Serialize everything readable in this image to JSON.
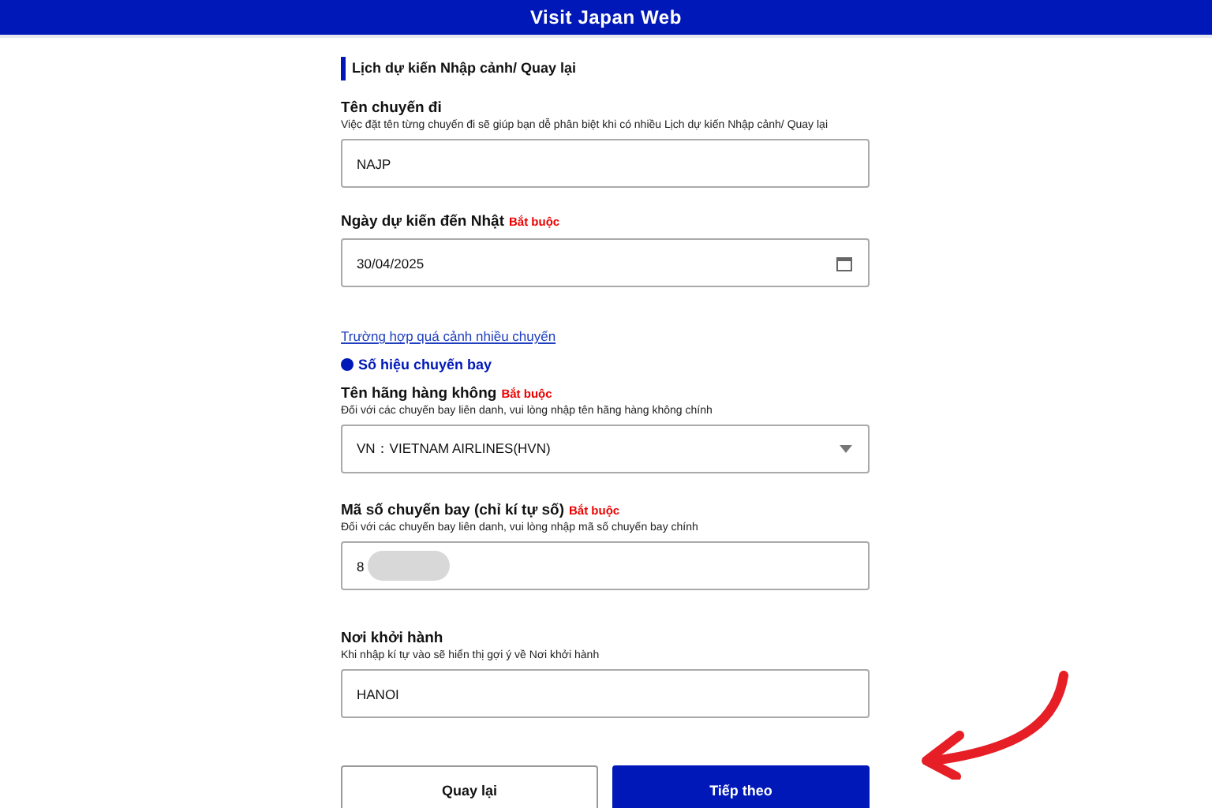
{
  "header": {
    "title": "Visit Japan Web"
  },
  "section_title": "Lịch dự kiến Nhập cảnh/ Quay lại",
  "fields_top": [
    {
      "kind": "text",
      "label": "Tên chuyến đi",
      "hint": "Việc đặt tên từng chuyến đi sẽ giúp bạn dễ phân biệt khi có nhiều Lịch dự kiến Nhập cảnh/ Quay lại",
      "value": "NAJP"
    },
    {
      "kind": "date",
      "label": "Ngày dự kiến đến Nhật",
      "required": "Bắt buộc",
      "value": "30/04/2025"
    }
  ],
  "link": "Trường hợp quá cảnh nhiều chuyến",
  "subsection": "Số hiệu chuyến bay",
  "fields_bottom": [
    {
      "kind": "select",
      "label": "Tên hãng hàng không",
      "required": "Bắt buộc",
      "hint": "Đối với các chuyến bay liên danh, vui lòng nhập tên hãng hàng không chính",
      "value": "VN：VIETNAM AIRLINES(HVN)"
    },
    {
      "kind": "redacted",
      "label": "Mã số chuyến bay (chỉ kí tự số)",
      "required": "Bắt buộc",
      "hint": "Đối với các chuyến bay liên danh, vui lòng nhập mã số chuyến bay chính",
      "value": "8"
    },
    {
      "kind": "text",
      "label": "Nơi khởi hành",
      "hint": "Khi nhập kí tự vào sẽ hiển thị gợi ý về Nơi khởi hành",
      "value": "HANOI"
    }
  ],
  "buttons": [
    {
      "label": "Quay lại",
      "kind": "secondary"
    },
    {
      "label": "Tiếp theo",
      "kind": "primary"
    }
  ]
}
